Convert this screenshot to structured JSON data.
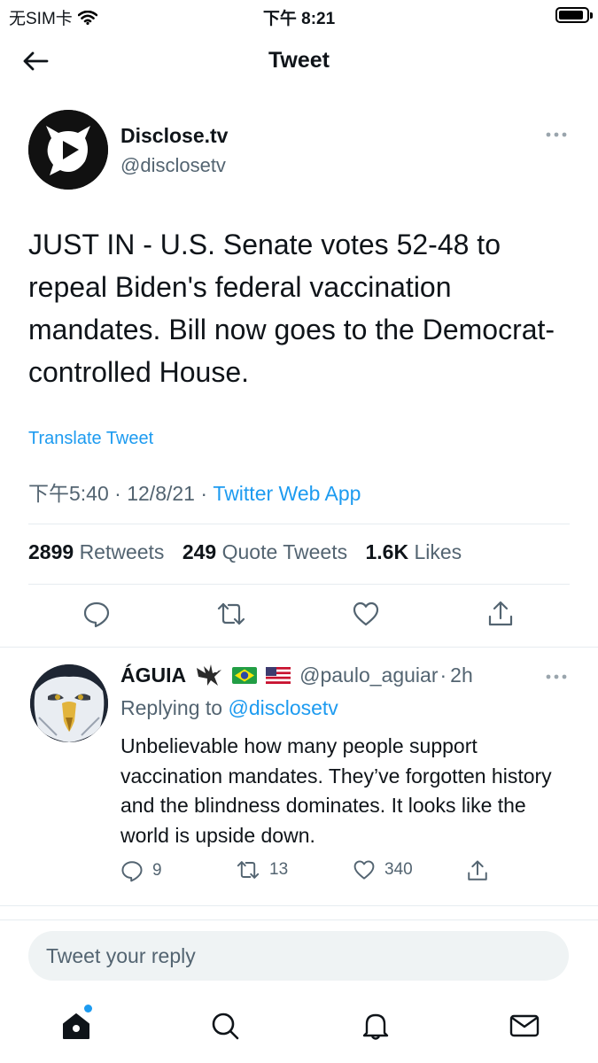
{
  "status_bar": {
    "carrier": "无SIM卡",
    "time": "下午 8:21",
    "battery_level": 0.9
  },
  "nav": {
    "title": "Tweet",
    "back_icon": "arrow-left-icon"
  },
  "tweet": {
    "author_name": "Disclose.tv",
    "author_handle": "@disclosetv",
    "text": "JUST IN - U.S. Senate votes 52-48 to repeal Biden's federal vaccination mandates. Bill now goes to the Democrat-controlled House.",
    "translate_label": "Translate Tweet",
    "time": "下午5:40",
    "date": "12/8/21",
    "source": "Twitter Web App",
    "stats": {
      "retweets_count": "2899",
      "retweets_label": "Retweets",
      "quotes_count": "249",
      "quotes_label": "Quote Tweets",
      "likes_count": "1.6K",
      "likes_label": "Likes"
    },
    "actions": [
      "reply-icon",
      "retweet-icon",
      "like-icon",
      "share-icon"
    ]
  },
  "reply": {
    "name": "ÁGUIA",
    "handle": "@paulo_aguiar",
    "age": "2h",
    "replying_prefix": "Replying to",
    "replying_to": "@disclosetv",
    "text": "Unbelievable how many people support vaccination mandates. They’ve forgotten history and the blindness dominates. It looks like the world is upside down.",
    "reply_count": "9",
    "retweet_count": "13",
    "like_count": "340"
  },
  "compose": {
    "placeholder": "Tweet your reply"
  },
  "tabbar": {
    "items": [
      "home-icon",
      "search-icon",
      "notifications-icon",
      "messages-icon"
    ],
    "accent": "#1d9bf0"
  }
}
